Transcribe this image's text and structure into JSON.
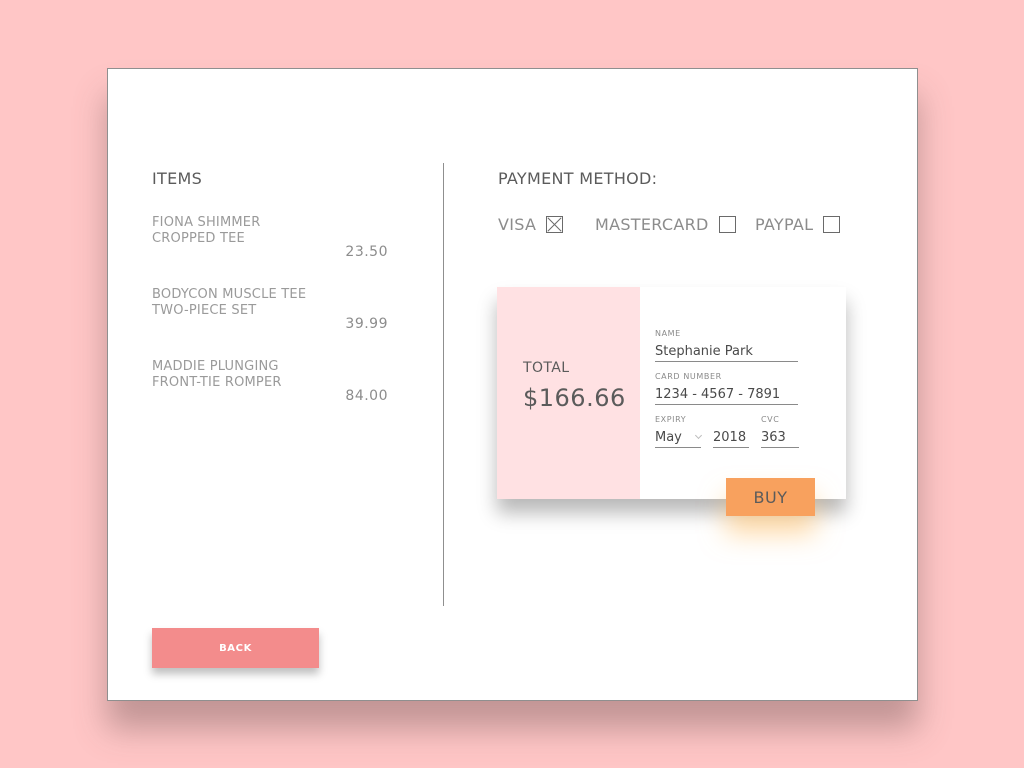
{
  "items": {
    "heading": "ITEMS",
    "list": [
      {
        "name_line1": "FIONA SHIMMER",
        "name_line2": "CROPPED TEE",
        "price": "23.50"
      },
      {
        "name_line1": "BODYCON MUSCLE TEE",
        "name_line2": "TWO-PIECE SET",
        "price": "39.99"
      },
      {
        "name_line1": "MADDIE PLUNGING",
        "name_line2": "FRONT-TIE ROMPER",
        "price": "84.00"
      }
    ]
  },
  "payment": {
    "heading": "PAYMENT METHOD:",
    "methods": [
      {
        "label": "VISA",
        "checked": true
      },
      {
        "label": "MASTERCARD",
        "checked": false
      },
      {
        "label": "PAYPAL",
        "checked": false
      }
    ]
  },
  "card": {
    "total_label": "TOTAL",
    "total_amount": "$166.66",
    "name_label": "NAME",
    "name_value": "Stephanie Park",
    "number_label": "CARD NUMBER",
    "number_value": "1234 - 4567 - 7891",
    "expiry_label": "EXPIRY",
    "expiry_month": "May",
    "expiry_year": "2018",
    "cvc_label": "CVC",
    "cvc_value": "363",
    "buy_label": "BUY"
  },
  "back_label": "BACK",
  "colors": {
    "background": "#ffc6c6",
    "total_panel": "#ffe1e3",
    "buy_button": "#f8a15e",
    "back_button": "#f38c8c"
  }
}
